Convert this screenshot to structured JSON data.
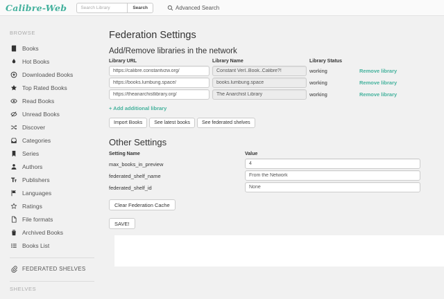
{
  "colors": {
    "accent": "#45b29d",
    "header_bg": "#fafafa",
    "page_bg": "#f1f1f1"
  },
  "header": {
    "logo": "Calibre-Web",
    "search": {
      "placeholder": "Search Library",
      "button": "Search"
    },
    "advanced_search": {
      "icon": "search-icon",
      "label": "Advanced Search"
    }
  },
  "sidebar": {
    "browse_header": "BROWSE",
    "items": [
      {
        "label": "Books",
        "icon": "book-icon"
      },
      {
        "label": "Hot Books",
        "icon": "fire-icon"
      },
      {
        "label": "Downloaded Books",
        "icon": "download-icon"
      },
      {
        "label": "Top Rated Books",
        "icon": "star-icon"
      },
      {
        "label": "Read Books",
        "icon": "eye-open-icon"
      },
      {
        "label": "Unread Books",
        "icon": "eye-close-icon"
      },
      {
        "label": "Discover",
        "icon": "random-icon"
      },
      {
        "label": "Categories",
        "icon": "inbox-icon"
      },
      {
        "label": "Series",
        "icon": "bookmark-icon"
      },
      {
        "label": "Authors",
        "icon": "user-icon"
      },
      {
        "label": "Publishers",
        "icon": "text-size-icon"
      },
      {
        "label": "Languages",
        "icon": "flag-icon"
      },
      {
        "label": "Ratings",
        "icon": "star-empty-icon"
      },
      {
        "label": "File formats",
        "icon": "file-icon"
      },
      {
        "label": "Archived Books",
        "icon": "trash-icon"
      },
      {
        "label": "Books List",
        "icon": "list-icon"
      }
    ],
    "federated_shelves": {
      "label": "FEDERATED SHELVES",
      "icon": "paperclip-icon"
    },
    "shelves_header": "SHELVES"
  },
  "main": {
    "title": "Federation Settings",
    "libraries_section": {
      "heading": "Add/Remove libraries in the network",
      "columns": [
        "Library URL",
        "Library Name",
        "Library Status"
      ],
      "rows": [
        {
          "url": "https://calibre.constantvzw.org/",
          "name": "Constant Verl..Book..Calibre?!",
          "status": "working",
          "action": "Remove library"
        },
        {
          "url": "https://books.lumbung.space/",
          "name": "books.lumbung.space",
          "status": "working",
          "action": "Remove library"
        },
        {
          "url": "https://theanarchistlibrary.org/",
          "name": "The Anarchist Library",
          "status": "working",
          "action": "Remove library"
        }
      ],
      "add_link": "+ Add additional library",
      "buttons": [
        "Import Books",
        "See latest books",
        "See federated shelves"
      ]
    },
    "other_settings": {
      "heading": "Other Settings",
      "columns": [
        "Setting Name",
        "Value"
      ],
      "rows": [
        {
          "name": "max_books_in_preview",
          "value": "4"
        },
        {
          "name": "federated_shelf_name",
          "value": "From the Network"
        },
        {
          "name": "federated_shelf_id",
          "value": "None"
        }
      ]
    },
    "clear_cache_button": "Clear Federation Cache",
    "save_button": "SAVE!"
  }
}
